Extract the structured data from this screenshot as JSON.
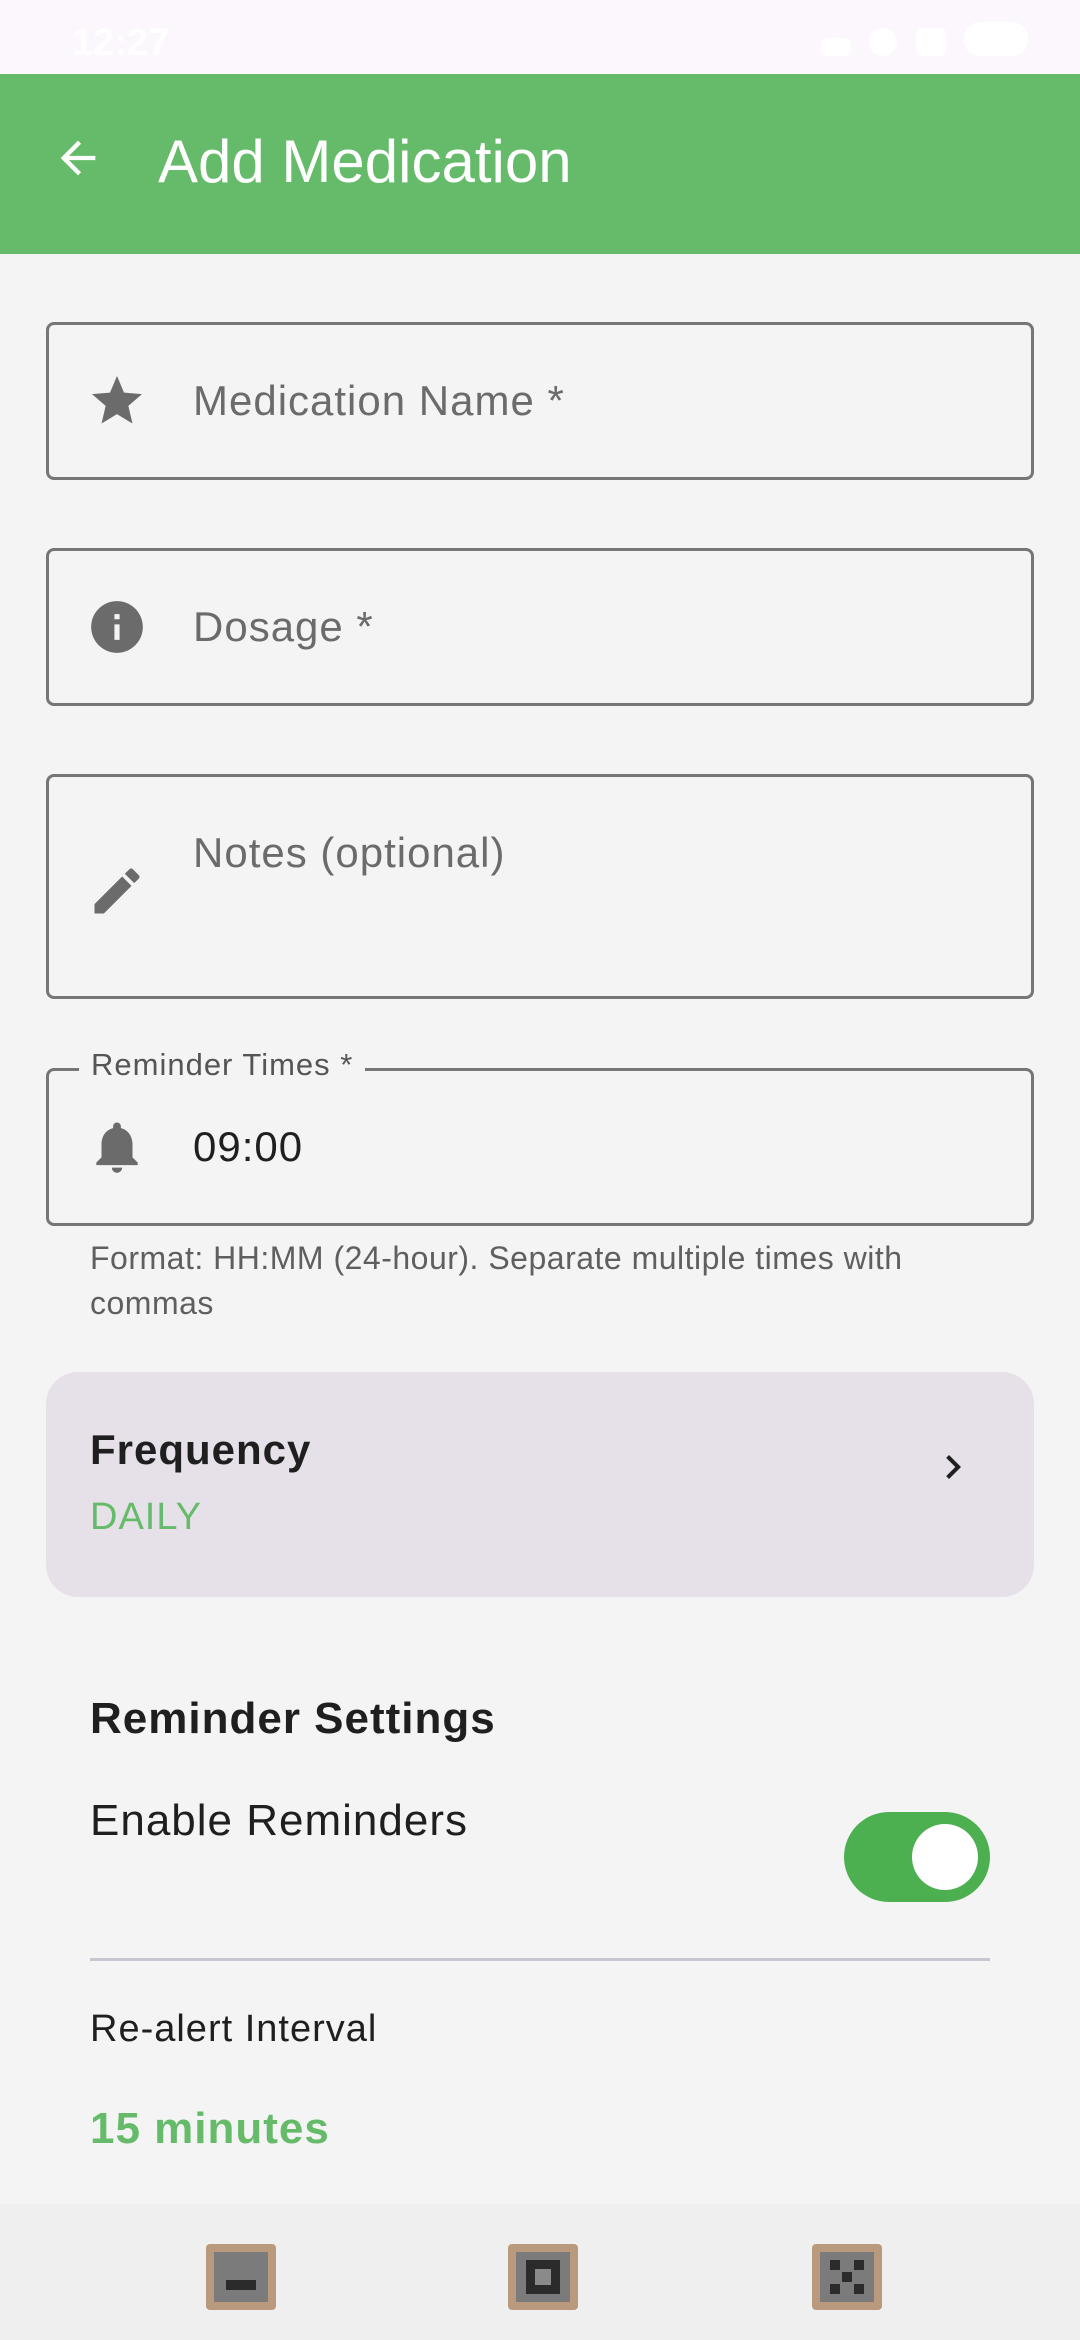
{
  "status_bar": {
    "time": "12:27"
  },
  "app_bar": {
    "title": "Add Medication",
    "back_icon": "arrow-back-icon"
  },
  "form": {
    "medication_name": {
      "placeholder": "Medication Name *",
      "icon": "star-icon"
    },
    "dosage": {
      "placeholder": "Dosage *",
      "icon": "info-icon"
    },
    "notes": {
      "placeholder": "Notes (optional)",
      "icon": "pencil-icon"
    },
    "reminder_times": {
      "label": "Reminder Times *",
      "value": "09:00",
      "icon": "bell-icon",
      "helper": "Format: HH:MM (24-hour). Separate multiple times with commas"
    },
    "frequency": {
      "title": "Frequency",
      "value": "DAILY"
    }
  },
  "reminder_settings": {
    "title": "Reminder Settings",
    "enable_label": "Enable Reminders",
    "enabled": true,
    "realert_label": "Re-alert Interval",
    "realert_value": "15 minutes"
  },
  "nav_bar": {
    "items": [
      "back-nav-icon",
      "home-nav-icon",
      "recents-nav-icon"
    ]
  },
  "colors": {
    "primary": "#66bb6a",
    "toggle_on": "#4caf50",
    "card": "#e6e1e8",
    "background": "#f4f4f4"
  }
}
